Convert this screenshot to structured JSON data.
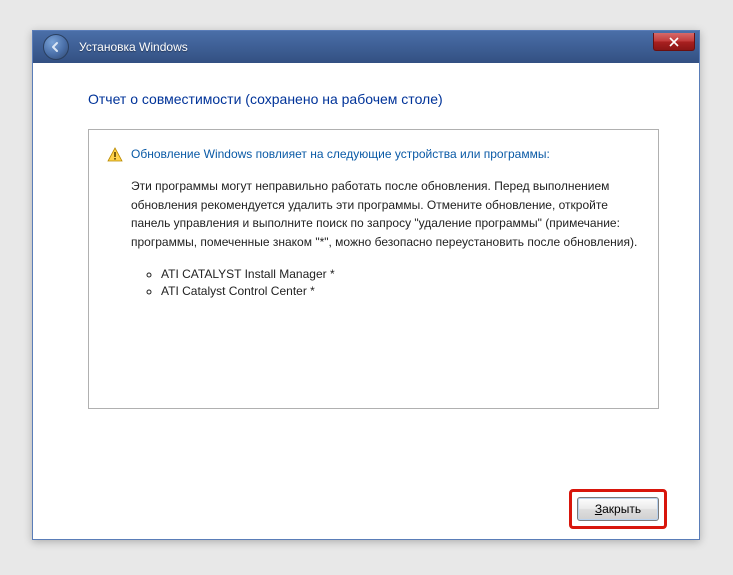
{
  "titlebar": {
    "title": "Установка Windows"
  },
  "heading": "Отчет о совместимости (сохранено на рабочем столе)",
  "report": {
    "warning_title": "Обновление Windows повлияет на следующие устройства или программы:",
    "warning_body": "Эти программы могут неправильно работать после обновления. Перед выполнением обновления рекомендуется удалить эти программы. Отмените обновление, откройте панель управления и выполните поиск по запросу \"удаление программы\" (примечание: программы, помеченные знаком \"*\", можно безопасно переустановить после обновления).",
    "items": [
      "ATI CATALYST Install Manager *",
      "ATI Catalyst Control Center *"
    ]
  },
  "footer": {
    "close_label_prefix": "З",
    "close_label_rest": "акрыть"
  }
}
